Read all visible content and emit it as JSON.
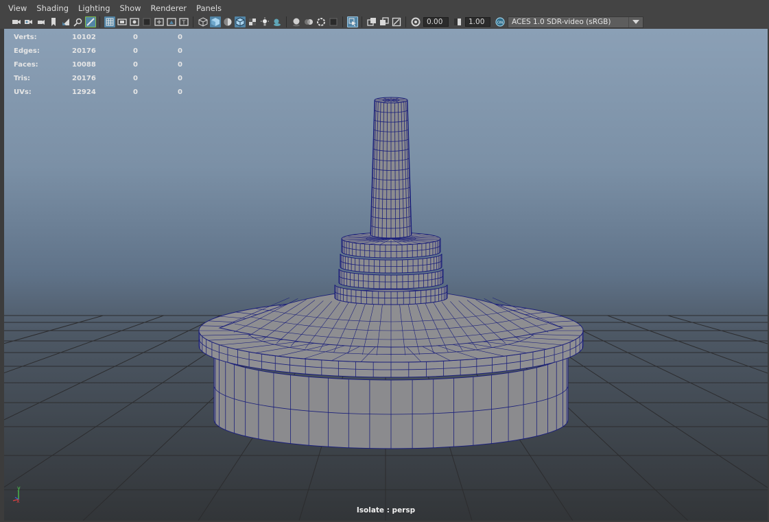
{
  "menu": {
    "items": [
      "View",
      "Shading",
      "Lighting",
      "Show",
      "Renderer",
      "Panels"
    ]
  },
  "toolbar": {
    "exposure": "0.00",
    "gamma": "1.00",
    "color_space": "ACES 1.0 SDR-video (sRGB)",
    "icons_group1": [
      "camera-select-icon",
      "camera-attributes-icon",
      "bookmark-icon",
      "image-plane-icon",
      "2d-pan-zoom-icon",
      "grease-pencil-icon"
    ],
    "icons_group2": [
      "grid-icon",
      "film-gate-icon",
      "resolution-gate-icon",
      "gate-mask-icon",
      "field-chart-icon",
      "safe-action-icon",
      "safe-title-icon"
    ],
    "icons_group3": [
      "wireframe-icon",
      "smooth-shade-icon",
      "default-material-icon",
      "wireframe-on-shaded-icon",
      "textured-icon",
      "use-all-lights-icon",
      "shadows-icon"
    ],
    "icons_group4": [
      "screen-space-ao-icon",
      "motion-blur-icon",
      "anti-aliasing-icon",
      "depth-of-field-icon"
    ],
    "icons_group5": [
      "isolate-select-icon"
    ],
    "icons_group6": [
      "xray-icon",
      "xray-active-components-icon",
      "xray-joints-icon"
    ],
    "colors": {
      "active": "#5285a6",
      "background": "#444444"
    }
  },
  "hud": {
    "rows": [
      {
        "label": "Verts:",
        "v1": "10102",
        "v2": "0",
        "v3": "0"
      },
      {
        "label": "Edges:",
        "v1": "20176",
        "v2": "0",
        "v3": "0"
      },
      {
        "label": "Faces:",
        "v1": "10088",
        "v2": "0",
        "v3": "0"
      },
      {
        "label": "Tris:",
        "v1": "20176",
        "v2": "0",
        "v3": "0"
      },
      {
        "label": "UVs:",
        "v1": "12924",
        "v2": "0",
        "v3": "0"
      }
    ]
  },
  "viewport": {
    "camera_label": "Isolate : persp",
    "axis": {
      "y": "y",
      "x": "x"
    },
    "colors": {
      "mesh_fill": "#8a8a8c",
      "wire": "#1a1f7a",
      "grid": "#2c2c2e"
    }
  }
}
